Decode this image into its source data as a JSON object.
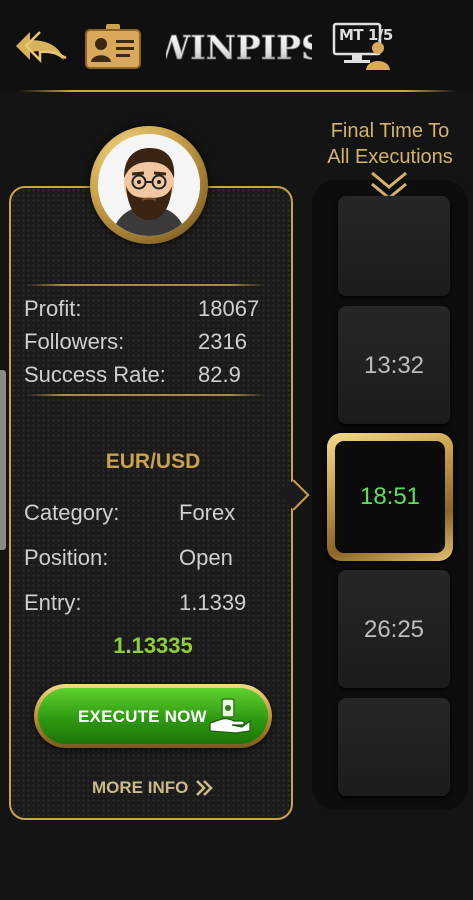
{
  "header": {
    "brand": "WINPIPS",
    "mt_label": "MT",
    "mt_counter": "1/5",
    "icons": [
      "back-arrows-icon",
      "id-card-icon",
      "mt-user-icon"
    ]
  },
  "trader": {
    "stats": [
      {
        "label": "Profit:",
        "value": "18067"
      },
      {
        "label": "Followers:",
        "value": "2316"
      },
      {
        "label": "Success Rate:",
        "value": "82.9"
      }
    ],
    "pair": "EUR/USD",
    "details": [
      {
        "label": "Category:",
        "value": "Forex"
      },
      {
        "label": "Position:",
        "value": "Open"
      },
      {
        "label": "Entry:",
        "value": "1.1339"
      }
    ],
    "current_price": "1.13335",
    "execute_label": "EXECUTE NOW",
    "more_info_label": "MORE INFO"
  },
  "timer": {
    "title_line1": "Final Time To",
    "title_line2": "All Executions",
    "times": [
      "13:32",
      "18:51",
      "26:25"
    ],
    "active_index": 1
  },
  "colors": {
    "gold": "#c9a24b",
    "green_button": "#2f9a12",
    "active_time": "#5ee05a",
    "price": "#8fd12f",
    "background": "#141414"
  }
}
